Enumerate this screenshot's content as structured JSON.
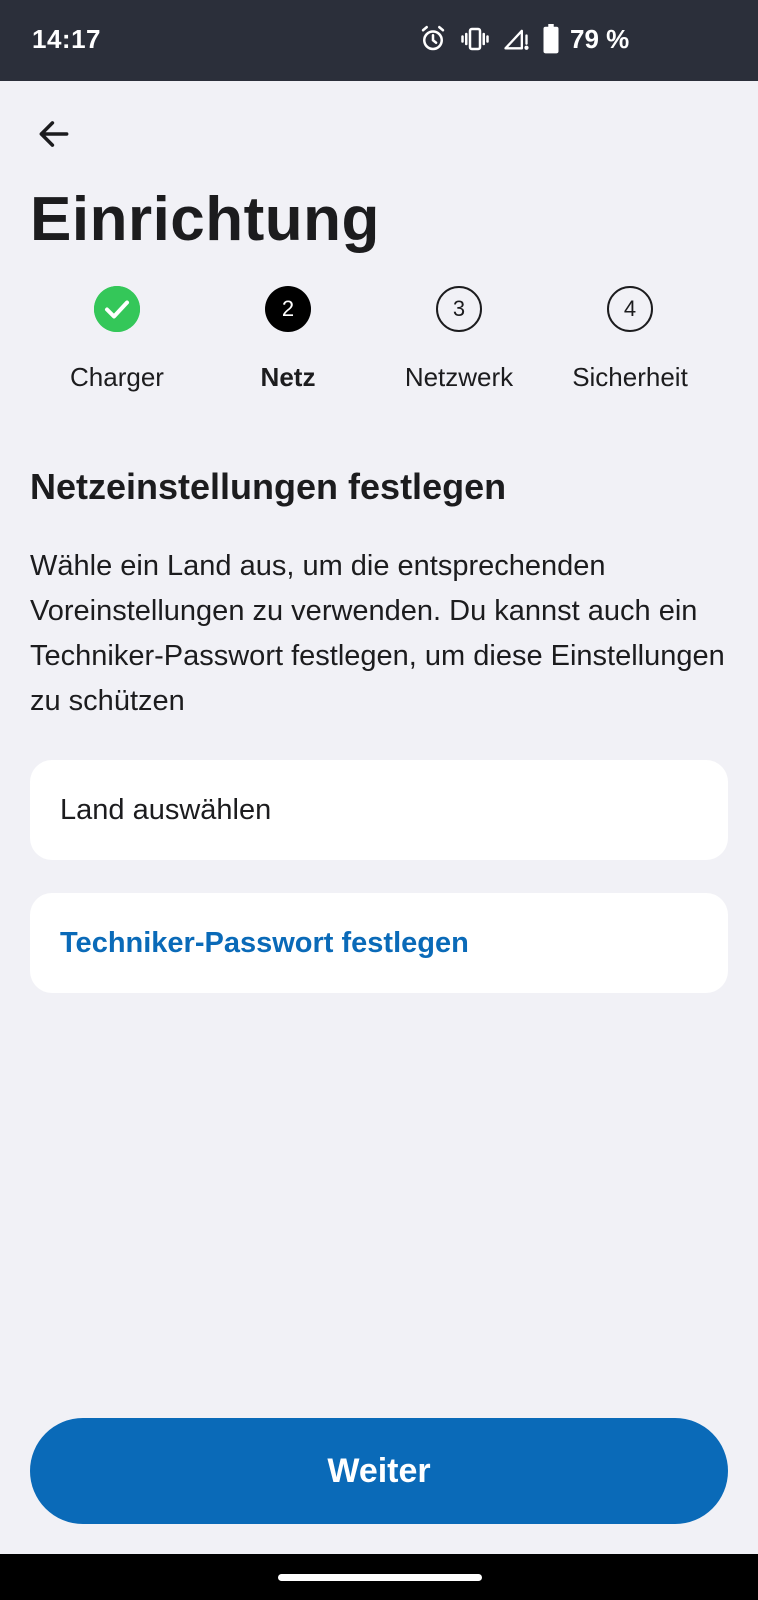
{
  "status_bar": {
    "time": "14:17",
    "battery": "79 %",
    "icons": [
      "alarm-icon",
      "vibrate-icon",
      "signal-icon",
      "battery-icon"
    ]
  },
  "header": {
    "back_icon": "arrow-left-icon",
    "title": "Einrichtung"
  },
  "stepper": {
    "steps": [
      {
        "label": "Charger",
        "marker": "",
        "state": "done"
      },
      {
        "label": "Netz",
        "marker": "2",
        "state": "active"
      },
      {
        "label": "Netzwerk",
        "marker": "3",
        "state": "todo"
      },
      {
        "label": "Sicherheit",
        "marker": "4",
        "state": "todo"
      }
    ]
  },
  "main": {
    "section_title": "Netzeinstellungen festlegen",
    "description": "Wähle ein Land aus, um die entsprechenden Voreinstellungen zu verwenden. Du kannst auch ein Techniker-Passwort festlegen, um diese Einstellungen zu schützen",
    "country_select_label": "Land auswählen",
    "technician_password_label": "Techniker-Passwort festlegen"
  },
  "footer": {
    "continue_label": "Weiter"
  },
  "colors": {
    "accent": "#0a6ab8",
    "success": "#34c759",
    "background": "#f1f1f6",
    "status_bar": "#2b2f3a"
  }
}
